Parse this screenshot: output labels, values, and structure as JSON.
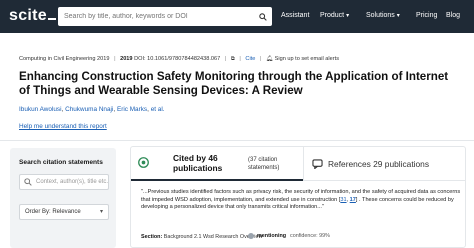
{
  "header": {
    "logo": "scite",
    "search_placeholder": "Search by title, author, keywords or DOI",
    "nav": {
      "assistant": "Assistant",
      "product": "Product",
      "solutions": "Solutions",
      "pricing": "Pricing",
      "blog": "Blog"
    }
  },
  "paper": {
    "venue": "Computing in Civil Engineering 2019",
    "year": "2019",
    "doi_label": "DOI:",
    "doi": "10.1061/9780784482438.067",
    "cite_label": "Cite",
    "email_alert": "Sign up to set email alerts",
    "title": "Enhancing Construction Safety Monitoring through the Application of Internet of Things and Wearable Sensing Devices: A Review",
    "authors": [
      "Ibukun Awolusi",
      "Chukwuma Nnaji",
      "Eric Marks"
    ],
    "et_al": "et al.",
    "help_link": "Help me understand this report"
  },
  "sidebar": {
    "title": "Search citation statements",
    "filter_placeholder": "Context, author(s), title etc.",
    "order_label": "Order By: Relevance"
  },
  "citations": {
    "cited_label": "Cited by 46 publications",
    "statements_count": "(37 citation statements)",
    "references_label": "References 29 publications",
    "snippet_pre": "\"...Previous studies identified factors such as privacy risk, the security of information, and the safety of acquired data as concerns that impeded WSD adoption, implementation, and extended use in construction [",
    "cite_1": "31",
    "cite_mid": ", ",
    "cite_2": "17",
    "snippet_post": "] . These concerns could be reduced by developing a personalized device that only transmits critical information...\"",
    "section_label": "Section:",
    "section_value": "Background 2.1 Wsd Research Overview",
    "mention_label": "mentioning",
    "confidence": "confidence: 99%"
  },
  "colors": {
    "topbar": "#1f2a36",
    "link": "#1a5fb4",
    "cited_icon": "#2e8b57"
  }
}
